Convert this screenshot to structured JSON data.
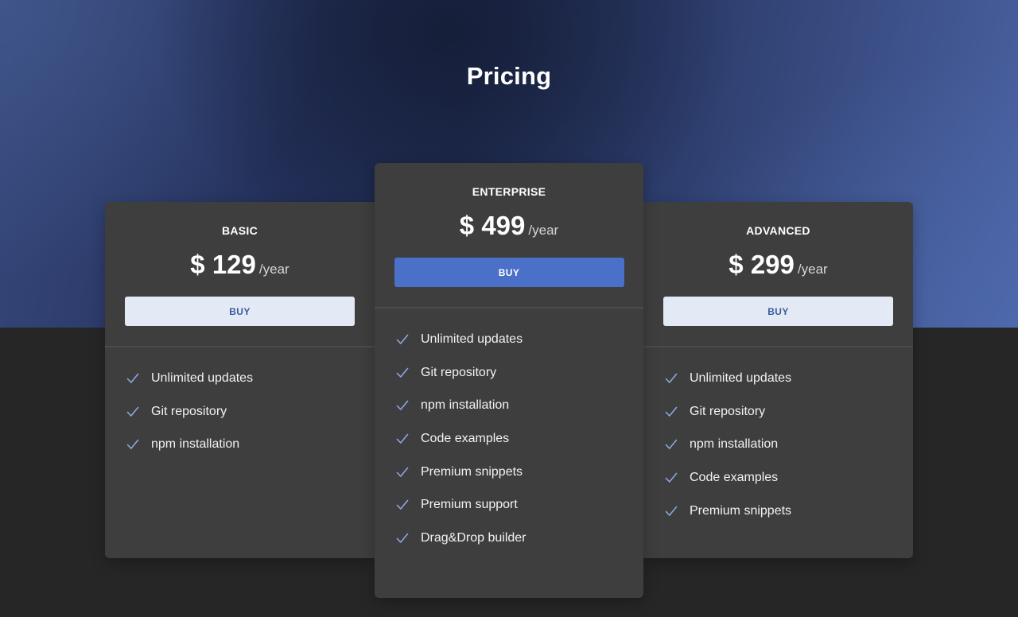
{
  "hero": {
    "title": "Pricing"
  },
  "colors": {
    "accent": "#4a70c8",
    "card_bg": "#3e3e3e",
    "page_bg": "#262626",
    "check": "#8ea6e0"
  },
  "plans": [
    {
      "name": "BASIC",
      "price": "$ 129",
      "period": "/year",
      "button_label": "BUY",
      "features": [
        "Unlimited updates",
        "Git repository",
        "npm installation"
      ]
    },
    {
      "name": "ENTERPRISE",
      "price": "$ 499",
      "period": "/year",
      "button_label": "BUY",
      "features": [
        "Unlimited updates",
        "Git repository",
        "npm installation",
        "Code examples",
        "Premium snippets",
        "Premium support",
        "Drag&Drop builder"
      ]
    },
    {
      "name": "ADVANCED",
      "price": "$ 299",
      "period": "/year",
      "button_label": "BUY",
      "features": [
        "Unlimited updates",
        "Git repository",
        "npm installation",
        "Code examples",
        "Premium snippets"
      ]
    }
  ],
  "icons": {
    "feature_check": "check-icon"
  }
}
